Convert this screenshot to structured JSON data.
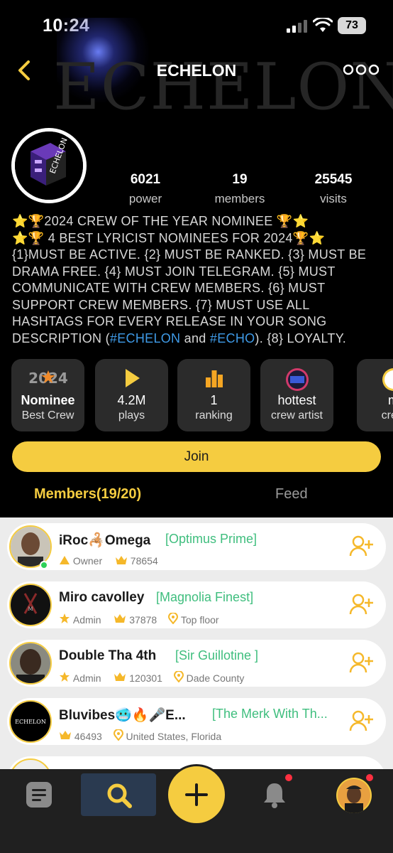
{
  "status": {
    "time": "10:24",
    "battery": "73"
  },
  "header": {
    "title": "ECHELON",
    "watermark": "ECHELON"
  },
  "crew": {
    "avatar_text": "ECHELON",
    "stats": [
      {
        "value": "6021",
        "label": "power"
      },
      {
        "value": "19",
        "label": "members"
      },
      {
        "value": "25545",
        "label": "visits"
      }
    ],
    "description": {
      "line1": "⭐🏆2024 CREW OF THE YEAR NOMINEE 🏆⭐",
      "line2": "⭐🏆 4 BEST LYRICIST NOMINEES FOR 2024🏆⭐",
      "body": "{1}MUST BE ACTIVE. {2} MUST BE RANKED. {3} MUST BE DRAMA FREE. {4} MUST JOIN TELEGRAM. {5} MUST COMMUNICATE WITH CREW MEMBERS. {6} MUST SUPPORT CREW MEMBERS. {7} MUST USE ALL HASHTAGS FOR EVERY RELEASE IN YOUR SONG DESCRIPTION (",
      "tag1": "#ECHELON",
      "mid": " and ",
      "tag2": "#ECHO",
      "end": "). {8} LOYALTY."
    }
  },
  "cards": [
    {
      "icon": "badge-2024-icon",
      "badge": "2024",
      "title": "Nominee",
      "subtitle": "Best Crew"
    },
    {
      "icon": "play-icon",
      "title": "4.2M",
      "subtitle": "plays"
    },
    {
      "icon": "ranking-bars-icon",
      "title": "1",
      "subtitle": "ranking"
    },
    {
      "icon": "artist-avatar",
      "title": "hottest",
      "subtitle": "crew artist"
    },
    {
      "icon": "artist-avatar",
      "title": "m",
      "subtitle": "crew"
    }
  ],
  "join_label": "Join",
  "tabs": [
    {
      "label": "Members(19/20)",
      "active": true
    },
    {
      "label": "Feed",
      "active": false
    }
  ],
  "members": [
    {
      "name": "iRoc🦂Omega",
      "title": "[Optimus Prime]",
      "role": "Owner",
      "score": "78654",
      "location": ""
    },
    {
      "name": "Miro cavolley",
      "title": "[Magnolia Finest]",
      "role": "Admin",
      "score": "37878",
      "location": "Top floor"
    },
    {
      "name": "Double Tha 4th",
      "title": "[Sir Guillotine ]",
      "role": "Admin",
      "score": "120301",
      "location": "Dade County"
    },
    {
      "name": "Bluvibes🥶🔥🎤E...",
      "title": "[The Merk With Th...",
      "role": "",
      "score": "46493",
      "location": "United States, Florida",
      "avatar_text": "ECHELON"
    }
  ],
  "colors": {
    "accent": "#f5cc40",
    "title_green": "#3fbe7e",
    "hashtag_blue": "#3f9be8",
    "background": "#000000"
  }
}
